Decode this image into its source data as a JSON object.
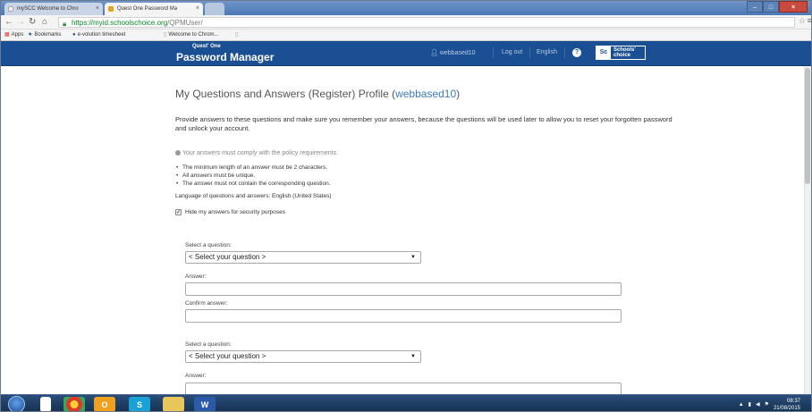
{
  "browser": {
    "tabs": [
      {
        "title": "mySCC Welcome to Chro",
        "active": false
      },
      {
        "title": "Quest One Password Ma",
        "active": true
      },
      {
        "title": "",
        "active": false
      }
    ],
    "close_glyph": "×",
    "url_host": "https://myid.schoolschoice.org",
    "url_path": "/QPMUser/",
    "bookmarks": {
      "apps": "Apps",
      "bookmarks": "Bookmarks",
      "evolution": "e-volution timesheet",
      "welcome": "Welcome to Chrom..."
    }
  },
  "header": {
    "brand_top": "Quest' One",
    "brand_main": "Password Manager",
    "username": "webbased10",
    "logout": "Log out",
    "language": "English",
    "logo_badge": "Sc",
    "logo_line1": "Schools'",
    "logo_line2": "choice"
  },
  "main": {
    "title_prefix": "My Questions and Answers (Register) Profile (",
    "title_user": "webbased10",
    "title_suffix": ")",
    "intro": "Provide answers to these questions and make sure you remember your answers, because the questions will be used later to allow you to reset your forgotten password and unlock your account.",
    "policy_head": "Your answers must comply with the policy requirements.",
    "rules": [
      "The minimum length of an answer must be 2 characters.",
      "All answers must be unique.",
      "The answer must not contain the corresponding question."
    ],
    "language_note": "Language of questions and answers: English (United States)",
    "hide_label": "Hide my answers for security purposes",
    "hide_checked": true,
    "question_blocks": [
      {
        "select_label": "Select a question:",
        "select_value": "< Select your question >",
        "answer_label": "Answer:",
        "confirm_label": "Confirm answer:"
      },
      {
        "select_label": "Select a question:",
        "select_value": "< Select your question >",
        "answer_label": "Answer:"
      }
    ]
  },
  "taskbar": {
    "time": "08:37",
    "date": "21/08/2015"
  },
  "colors": {
    "header_bg": "#1a4f93",
    "link": "#3c7bc0",
    "taskbar_bg": "#1f3d63"
  }
}
